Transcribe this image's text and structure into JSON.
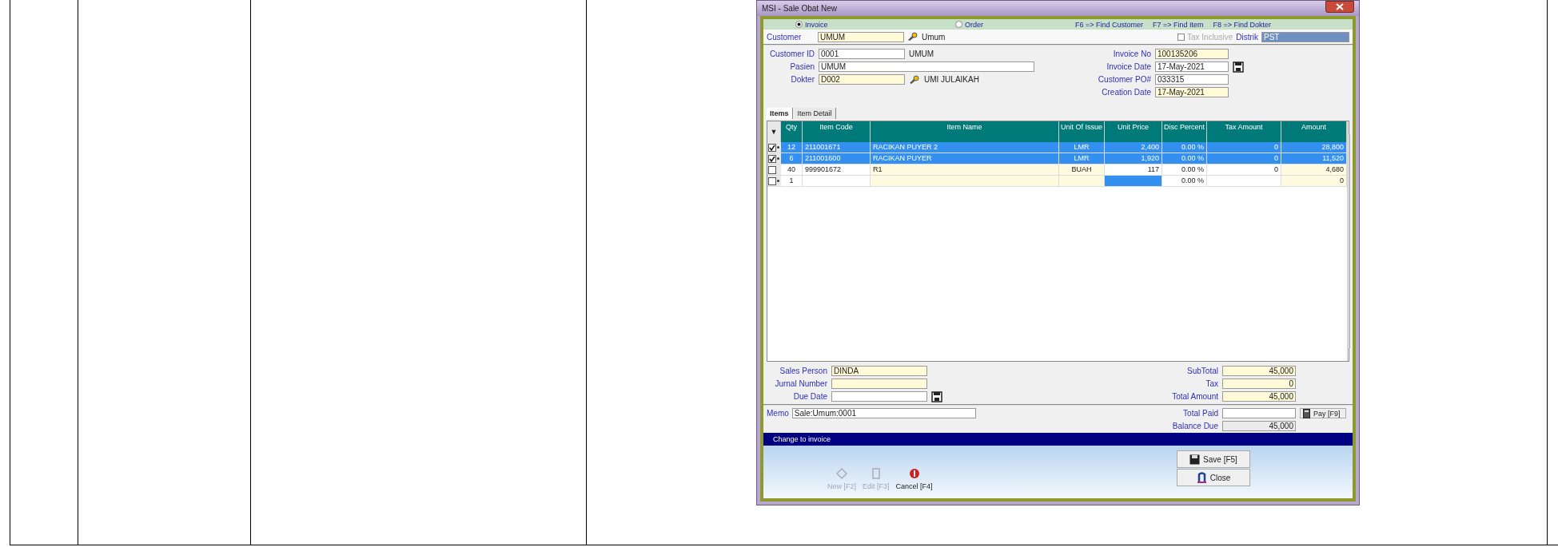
{
  "window": {
    "title": "MSI - Sale Obat New"
  },
  "mode_options": [
    {
      "label": "Invoice",
      "selected": true
    },
    {
      "label": "Order",
      "selected": false
    }
  ],
  "hotkeys": [
    "F6 => Find Customer",
    "F7 => Find Item",
    "F8 => Find Dokter"
  ],
  "customer": {
    "label": "Customer",
    "code": "UMUM",
    "name": "Umum"
  },
  "tax_inclusive": {
    "label": "Tax Inclusive",
    "checked": false,
    "disabled": true
  },
  "distrik": {
    "label": "Distrik",
    "value": "PST"
  },
  "left_fields": [
    {
      "label": "Customer ID",
      "value": "0001",
      "kind": "text",
      "note": "UMUM"
    },
    {
      "label": "Pasien",
      "value": "UMUM",
      "kind": "wide"
    },
    {
      "label": "Dokter",
      "value": "D002",
      "kind": "lookup",
      "note": "UMI JULAIKAH"
    }
  ],
  "right_fields": [
    {
      "label": "Invoice No",
      "value": "100135206",
      "kind": "readonly"
    },
    {
      "label": "Invoice Date",
      "value": "17-May-2021",
      "kind": "date"
    },
    {
      "label": "Customer PO#",
      "value": "033315",
      "kind": "text"
    },
    {
      "label": "Creation Date",
      "value": "17-May-2021",
      "kind": "readonly"
    }
  ],
  "tabs": [
    {
      "label": "Items",
      "selected": true
    },
    {
      "label": "Item Detail",
      "selected": false
    }
  ],
  "grid": {
    "corner": "▼",
    "columns": [
      "Qty",
      "Item Code",
      "Item Name",
      "Unit Of Issue",
      "Unit Price",
      "Disc Percent",
      "Tax Amount",
      "Amount"
    ],
    "rows": [
      {
        "checked": true,
        "selected": true,
        "marker": true,
        "editing": false,
        "cells": [
          "12",
          "211001671",
          "RACIKAN PUYER 2",
          "LMR",
          "2,400",
          "0.00 %",
          "0",
          "28,800"
        ]
      },
      {
        "checked": true,
        "selected": true,
        "marker": true,
        "editing": false,
        "cells": [
          "6",
          "211001600",
          "RACIKAN PUYER",
          "LMR",
          "1,920",
          "0.00 %",
          "0",
          "11,520"
        ]
      },
      {
        "checked": false,
        "selected": false,
        "marker": false,
        "editing": false,
        "cells": [
          "40",
          "999901672",
          "R1",
          "BUAH",
          "117",
          "0.00 %",
          "0",
          "4,680"
        ]
      },
      {
        "checked": false,
        "selected": false,
        "marker": true,
        "editing": true,
        "cells": [
          "1",
          null,
          null,
          null,
          null,
          "0.00 %",
          null,
          "0"
        ]
      }
    ]
  },
  "bottom_fields": [
    {
      "label": "Sales Person",
      "value": "DINDA",
      "kind": "readonly"
    },
    {
      "label": "Jurnal Number",
      "kind": "readonly"
    },
    {
      "label": "Due Date",
      "kind": "date"
    }
  ],
  "totals": [
    {
      "label": "SubTotal",
      "value": "45,000"
    },
    {
      "label": "Tax",
      "value": "0"
    },
    {
      "label": "Total Amount",
      "value": "45,000"
    }
  ],
  "memo": {
    "label": "Memo",
    "value": "Sale:Umum:0001"
  },
  "payment": [
    {
      "label": "Total Paid",
      "kind": "input"
    },
    {
      "label": "Balance Due",
      "value": "45,000",
      "kind": "readonly"
    }
  ],
  "pay_button": "Pay [F9]",
  "status": "Change to invoice",
  "actions": [
    {
      "label": "New [F2]",
      "kind": "new",
      "disabled": true
    },
    {
      "label": "Edit [F3]",
      "kind": "edit",
      "disabled": true
    },
    {
      "label": "Cancel [F4]",
      "kind": "cancel",
      "disabled": false
    }
  ],
  "side_buttons": [
    {
      "label": "Save [F5]",
      "kind": "save"
    },
    {
      "label": "Close",
      "kind": "close"
    }
  ]
}
